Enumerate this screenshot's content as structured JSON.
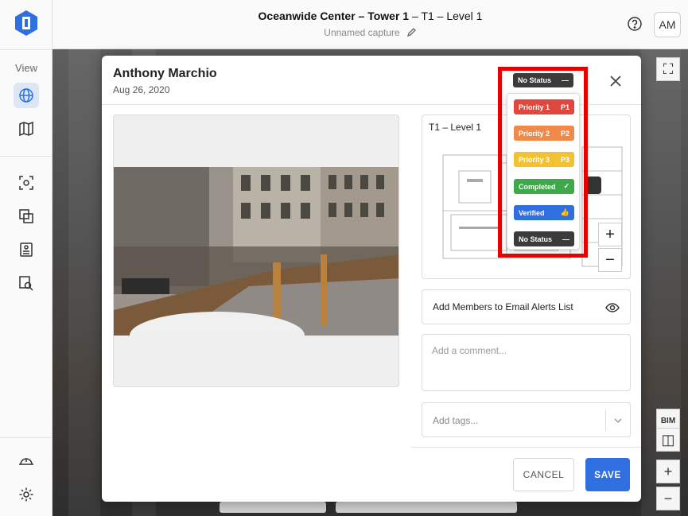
{
  "header": {
    "title_bold": "Oceanwide Center – Tower 1",
    "title_rest": " – T1 – Level 1",
    "subtitle": "Unnamed capture",
    "avatar": "AM"
  },
  "sidebar": {
    "view_label": "View",
    "items": [
      {
        "icon": "globe-icon"
      },
      {
        "icon": "map-icon"
      },
      {
        "icon": "capture-icon"
      },
      {
        "icon": "layers-icon"
      },
      {
        "icon": "document-icon"
      },
      {
        "icon": "search-doc-icon"
      },
      {
        "icon": "hard-hat-icon"
      },
      {
        "icon": "settings-icon"
      }
    ]
  },
  "modal": {
    "author": "Anthony Marchio",
    "date": "Aug 26, 2020",
    "map_title": "T1 – Level 1",
    "email_alerts": "Add Members to Email Alerts List",
    "comment_placeholder": "Add a comment...",
    "tags_placeholder": "Add tags...",
    "cancel": "CANCEL",
    "save": "SAVE",
    "zoom_in": "+",
    "zoom_out": "−"
  },
  "status": {
    "current": "No Status",
    "options": [
      {
        "label": "Priority 1",
        "tag": "P1",
        "color": "#e0483e"
      },
      {
        "label": "Priority 2",
        "tag": "P2",
        "color": "#ef8a4a"
      },
      {
        "label": "Priority 3",
        "tag": "P3",
        "color": "#f2c233"
      },
      {
        "label": "Completed",
        "tag": "✓",
        "color": "#3ea84b"
      },
      {
        "label": "Verified",
        "tag": "👍",
        "color": "#2f6fe0"
      },
      {
        "label": "No Status",
        "tag": "—",
        "color": "#3b3b3b"
      }
    ]
  },
  "viewer_controls": {
    "zoom_in": "+",
    "zoom_out": "−",
    "bim_label": "BIM"
  },
  "colors": {
    "accent": "#2f6fe0",
    "highlight": "#e60000"
  }
}
